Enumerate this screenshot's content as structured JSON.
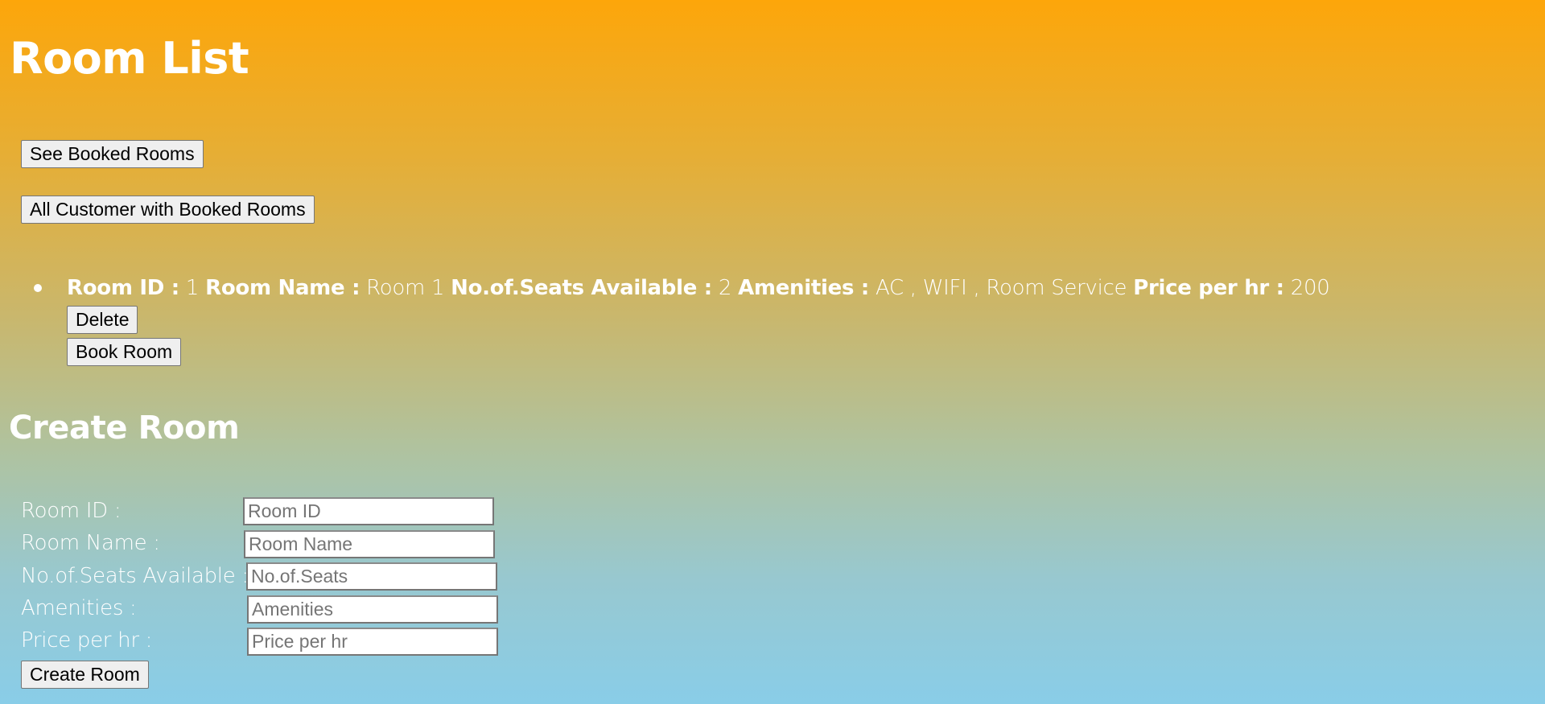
{
  "room_list": {
    "title": "Room List",
    "see_booked_rooms_label": "See Booked Rooms",
    "all_customers_label": "All Customer with Booked Rooms",
    "rooms": [
      {
        "id_label": "Room ID :",
        "id_value": "1",
        "name_label": "Room Name :",
        "name_value": "Room 1",
        "seats_label": "No.of.Seats Available :",
        "seats_value": "2",
        "amenities_label": "Amenities :",
        "amenities_value": "AC , WIFI , Room Service",
        "price_label": "Price per hr :",
        "price_value": "200",
        "delete_label": "Delete",
        "book_label": "Book Room"
      }
    ]
  },
  "create_room": {
    "title": "Create Room",
    "fields": [
      {
        "label": "Room ID :",
        "placeholder": "Room ID",
        "value": ""
      },
      {
        "label": "Room Name :",
        "placeholder": "Room Name",
        "value": ""
      },
      {
        "label": "No.of.Seats Available :",
        "placeholder": "No.of.Seats",
        "value": ""
      },
      {
        "label": "Amenities :",
        "placeholder": "Amenities",
        "value": ""
      },
      {
        "label": "Price per hr :",
        "placeholder": "Price per hr",
        "value": ""
      }
    ],
    "submit_label": "Create Room"
  },
  "colors": {
    "gradient_top": "#fda60a",
    "gradient_bottom": "#89cde8",
    "text": "#ffffff",
    "button_bg": "#efefef"
  }
}
